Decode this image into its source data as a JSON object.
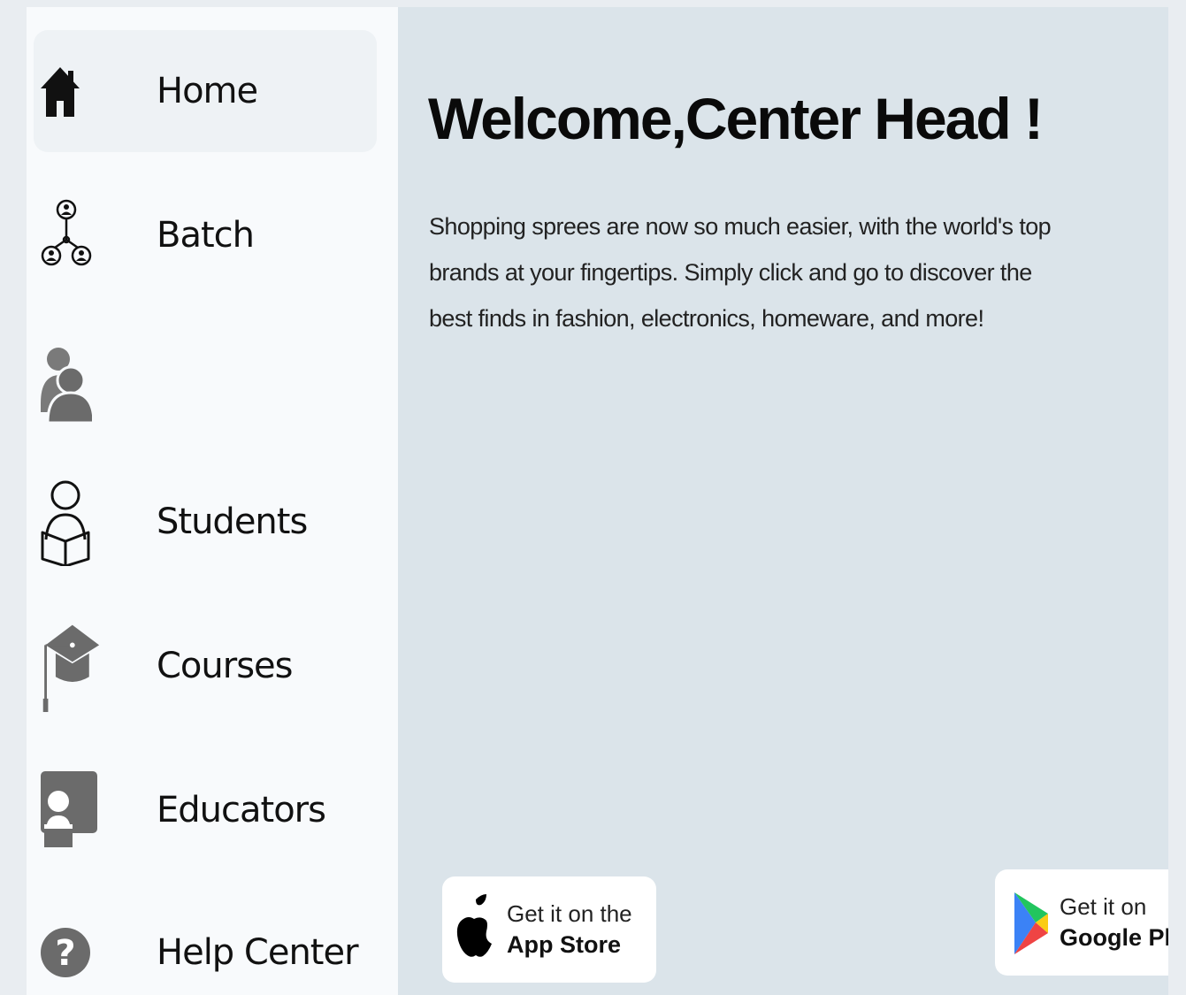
{
  "sidebar": {
    "items": [
      {
        "label": "Home",
        "icon": "home-icon",
        "active": true
      },
      {
        "label": "Batch",
        "icon": "network-icon",
        "active": false
      },
      {
        "label": "",
        "icon": "users-icon",
        "active": false
      },
      {
        "label": "Students",
        "icon": "student-icon",
        "active": false
      },
      {
        "label": "Courses",
        "icon": "graduation-cap-icon",
        "active": false
      },
      {
        "label": "Educators",
        "icon": "educator-icon",
        "active": false
      },
      {
        "label": "Help Center",
        "icon": "help-icon",
        "active": false
      }
    ]
  },
  "main": {
    "welcome": "Welcome,Center Head  !",
    "description": "Shopping sprees are now so much easier, with the world's top brands at your fingertips. Simply click and go to discover the best finds in fashion, electronics, homeware, and more!"
  },
  "stores": {
    "appstore": {
      "line1": "Get it on the",
      "line2": "App Store",
      "icon": "apple-icon"
    },
    "googleplay": {
      "line1": "Get it on",
      "line2": "Google Play",
      "icon": "google-play-icon"
    }
  },
  "colors": {
    "sidebar_bg": "#f8fafc",
    "main_bg": "#dbe4ea",
    "active_item_bg": "#eef2f5",
    "icon_gray": "#6b6b6b"
  }
}
